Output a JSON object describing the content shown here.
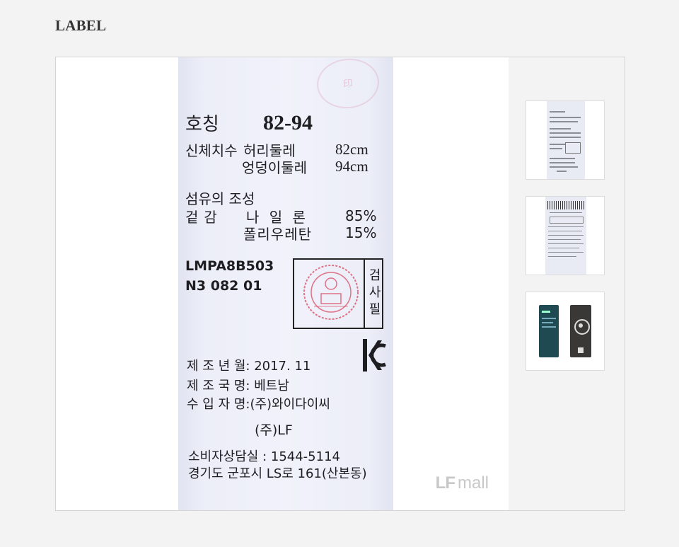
{
  "section": {
    "title": "LABEL"
  },
  "label": {
    "size_title": "호칭",
    "size_value": "82-94",
    "body_measure_label": "신체치수",
    "waist_label": "허리둘레",
    "waist_value": "82cm",
    "hip_label": "엉덩이둘레",
    "hip_value": "94cm",
    "fiber_title": "섬유의 조성",
    "outer_label": "겉감",
    "nylon_label": "나 일 론",
    "nylon_value": "85%",
    "polyurethane_label": "폴리우레탄",
    "polyurethane_value": "15%",
    "model_code": "LMPA8B503",
    "model_sub": "N3 082 01",
    "inspection_label": "검사필",
    "kc_mark": "KC",
    "mfg_date": "제 조 년 월: 2017. 11",
    "mfg_country": "제 조 국 명: 베트남",
    "importer": "수 입 자 명:(주)와이다이씨",
    "brand_company": "(주)LF",
    "cs_phone": "소비자상담실 : 1544-5114",
    "address": "경기도 군포시 LS로 161(산본동)"
  },
  "watermark": {
    "brand": "LF",
    "text": "mall"
  },
  "colors": {
    "page_bg": "#f3f3f3",
    "tag_bg": "#eef0f9",
    "seal_red": "#d9536a",
    "text": "#333333"
  },
  "icons": {
    "seal": "inspection-seal-icon",
    "kc": "kc-certification-icon"
  }
}
